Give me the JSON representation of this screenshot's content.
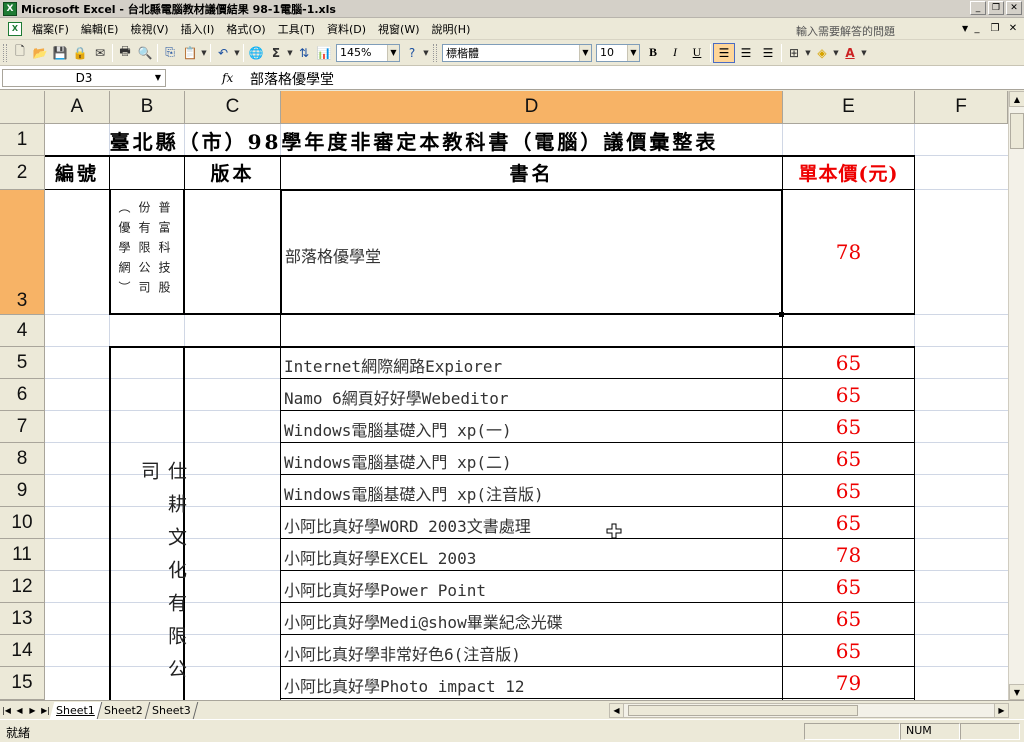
{
  "window": {
    "title": "Microsoft Excel - 台北縣電腦教材議價結果 98-1電腦-1.xls",
    "app_icon": "excel-icon"
  },
  "menu": {
    "items": [
      "檔案(F)",
      "編輯(E)",
      "檢視(V)",
      "插入(I)",
      "格式(O)",
      "工具(T)",
      "資料(D)",
      "視窗(W)",
      "說明(H)"
    ],
    "help_placeholder": "輸入需要解答的問題"
  },
  "toolbar": {
    "zoom": "145%",
    "font_name": "標楷體",
    "font_size": "10",
    "bold": "B",
    "italic": "I",
    "underline": "U",
    "sum": "Σ"
  },
  "formula_bar": {
    "name_box": "D3",
    "fx": "fx",
    "content": "部落格優學堂"
  },
  "grid": {
    "columns": [
      "A",
      "B",
      "C",
      "D",
      "E",
      "F"
    ],
    "selected_column": "D",
    "rows": [
      "1",
      "2",
      "3",
      "4",
      "5",
      "6",
      "7",
      "8",
      "9",
      "10",
      "11",
      "12",
      "13",
      "14",
      "15"
    ],
    "selected_row": "3",
    "title": "臺北縣（市）98學年度非審定本教科書（電腦）議價彙整表",
    "headers": {
      "number": "編號",
      "edition": "版本",
      "book_name": "書名",
      "unit_price": "單本價(元)"
    },
    "publisher_1": {
      "col1": "普富科技股",
      "col2": "份有限公司",
      "col3": "（優學網）"
    },
    "publisher_2": "仕耕文化有限公司",
    "books": [
      {
        "row": "3",
        "name": "部落格優學堂",
        "price": "78"
      },
      {
        "row": "5",
        "name": "Internet網際網路Expiorer",
        "price": "65"
      },
      {
        "row": "6",
        "name": "Namo 6網頁好好學Webeditor",
        "price": "65"
      },
      {
        "row": "7",
        "name": "Windows電腦基礎入門 xp(一)",
        "price": "65"
      },
      {
        "row": "8",
        "name": "Windows電腦基礎入門 xp(二)",
        "price": "65"
      },
      {
        "row": "9",
        "name": "Windows電腦基礎入門 xp(注音版)",
        "price": "65"
      },
      {
        "row": "10",
        "name": "小阿比真好學WORD 2003文書處理",
        "price": "65"
      },
      {
        "row": "11",
        "name": "小阿比真好學EXCEL 2003",
        "price": "78"
      },
      {
        "row": "12",
        "name": "小阿比真好學Power Point",
        "price": "65"
      },
      {
        "row": "13",
        "name": "小阿比真好學Medi@show畢業紀念光碟",
        "price": "65"
      },
      {
        "row": "14",
        "name": "小阿比真好學非常好色6(注音版)",
        "price": "65"
      },
      {
        "row": "15",
        "name": "小阿比真好學Photo impact 12",
        "price": "79"
      }
    ]
  },
  "sheets": [
    "Sheet1",
    "Sheet2",
    "Sheet3"
  ],
  "active_sheet": "Sheet1",
  "status": {
    "ready": "就緒",
    "num": "NUM"
  },
  "colors": {
    "selected_header": "#f7b366",
    "price_red": "#e00000",
    "title_bar": "#d4d0c8"
  }
}
